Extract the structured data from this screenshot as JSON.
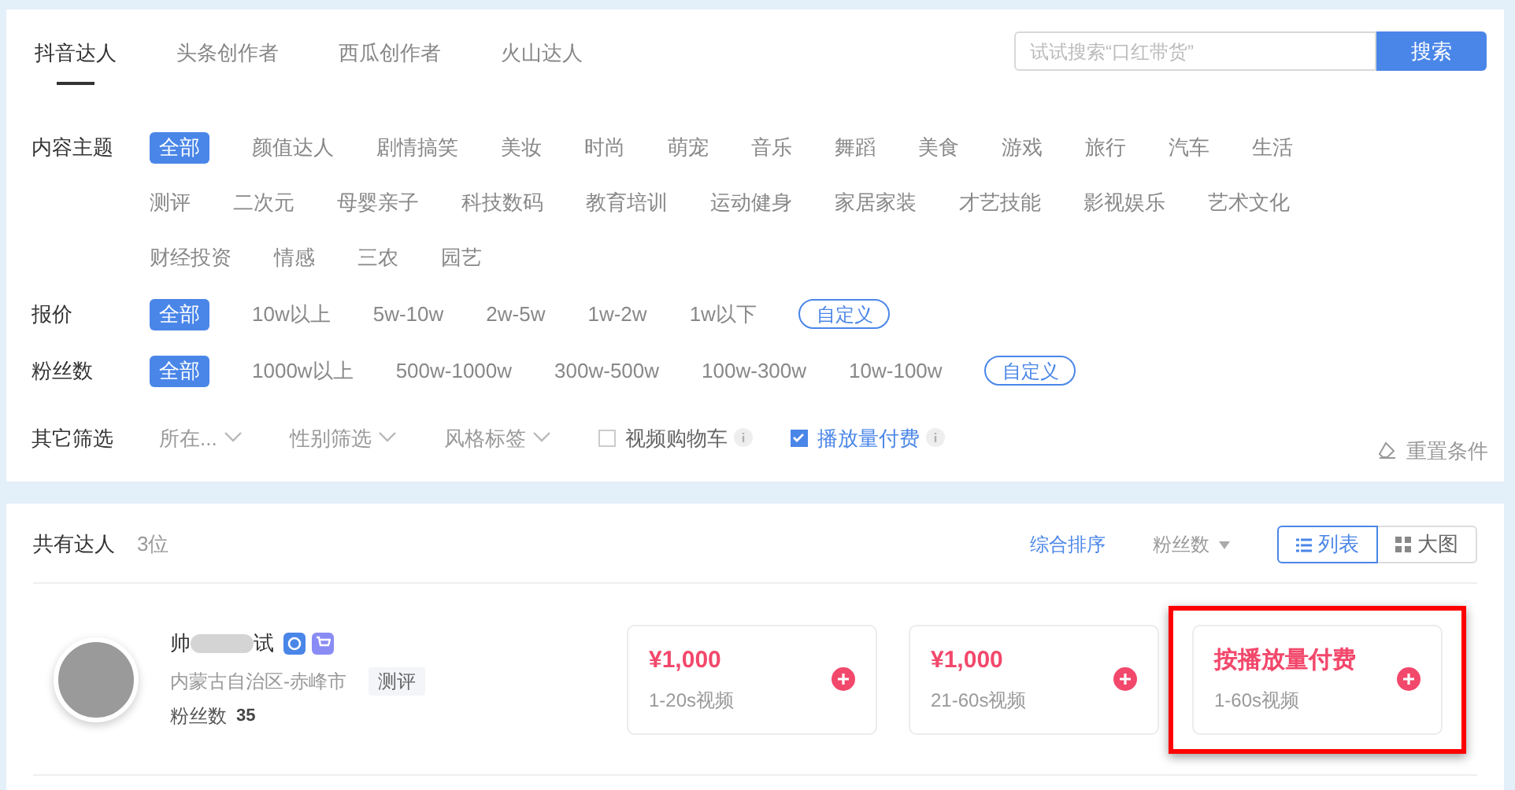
{
  "tabs": [
    {
      "label": "抖音达人",
      "selected": true
    },
    {
      "label": "头条创作者",
      "selected": false
    },
    {
      "label": "西瓜创作者",
      "selected": false
    },
    {
      "label": "火山达人",
      "selected": false
    }
  ],
  "search": {
    "placeholder": "试试搜索“口红带货”",
    "button": "搜索"
  },
  "filters": [
    {
      "label": "内容主题",
      "options": [
        {
          "label": "全部",
          "selected": true
        },
        {
          "label": "颜值达人",
          "selected": false
        },
        {
          "label": "剧情搞笑",
          "selected": false
        },
        {
          "label": "美妆",
          "selected": false
        },
        {
          "label": "时尚",
          "selected": false
        },
        {
          "label": "萌宠",
          "selected": false
        },
        {
          "label": "音乐",
          "selected": false
        },
        {
          "label": "舞蹈",
          "selected": false
        },
        {
          "label": "美食",
          "selected": false
        },
        {
          "label": "游戏",
          "selected": false
        },
        {
          "label": "旅行",
          "selected": false
        },
        {
          "label": "汽车",
          "selected": false
        },
        {
          "label": "生活",
          "selected": false
        },
        {
          "label": "测评",
          "selected": false
        },
        {
          "label": "二次元",
          "selected": false
        },
        {
          "label": "母婴亲子",
          "selected": false
        },
        {
          "label": "科技数码",
          "selected": false
        },
        {
          "label": "教育培训",
          "selected": false
        },
        {
          "label": "运动健身",
          "selected": false
        },
        {
          "label": "家居家装",
          "selected": false
        },
        {
          "label": "才艺技能",
          "selected": false
        },
        {
          "label": "影视娱乐",
          "selected": false
        },
        {
          "label": "艺术文化",
          "selected": false
        },
        {
          "label": "财经投资",
          "selected": false
        },
        {
          "label": "情感",
          "selected": false
        },
        {
          "label": "三农",
          "selected": false
        },
        {
          "label": "园艺",
          "selected": false
        }
      ]
    },
    {
      "label": "报价",
      "options": [
        {
          "label": "全部",
          "selected": true
        },
        {
          "label": "10w以上",
          "selected": false
        },
        {
          "label": "5w-10w",
          "selected": false
        },
        {
          "label": "2w-5w",
          "selected": false
        },
        {
          "label": "1w-2w",
          "selected": false
        },
        {
          "label": "1w以下",
          "selected": false
        }
      ],
      "custom": "自定义"
    },
    {
      "label": "粉丝数",
      "options": [
        {
          "label": "全部",
          "selected": true
        },
        {
          "label": "1000w以上",
          "selected": false
        },
        {
          "label": "500w-1000w",
          "selected": false
        },
        {
          "label": "300w-500w",
          "selected": false
        },
        {
          "label": "100w-300w",
          "selected": false
        },
        {
          "label": "10w-100w",
          "selected": false
        }
      ],
      "custom": "自定义"
    }
  ],
  "other_filters": {
    "label": "其它筛选",
    "dropdowns": [
      "所在...",
      "性别筛选",
      "风格标签"
    ],
    "checkboxes": [
      {
        "label": "视频购物车",
        "checked": false
      },
      {
        "label": "播放量付费",
        "checked": true
      }
    ],
    "reset": "重置条件"
  },
  "results": {
    "title": "共有达人",
    "count": "3位",
    "sorts": [
      {
        "label": "综合排序",
        "selected": true,
        "kind": "plain"
      },
      {
        "label": "粉丝数",
        "selected": false,
        "kind": "dropdown"
      }
    ],
    "views": [
      {
        "label": "列表",
        "selected": true,
        "kind": "list"
      },
      {
        "label": "大图",
        "selected": false,
        "kind": "grid"
      }
    ]
  },
  "creators": [
    {
      "name_start": "帅",
      "name_end": "试",
      "location": "内蒙古自治区-赤峰市",
      "tag": "测评",
      "fans_label": "粉丝数",
      "fans": "35",
      "prices": [
        {
          "price": "¥1,000",
          "desc": "1-20s视频",
          "highlighted": false
        },
        {
          "price": "¥1,000",
          "desc": "21-60s视频",
          "highlighted": false
        },
        {
          "price": "按播放量付费",
          "desc": "1-60s视频",
          "highlighted": true
        }
      ]
    }
  ]
}
